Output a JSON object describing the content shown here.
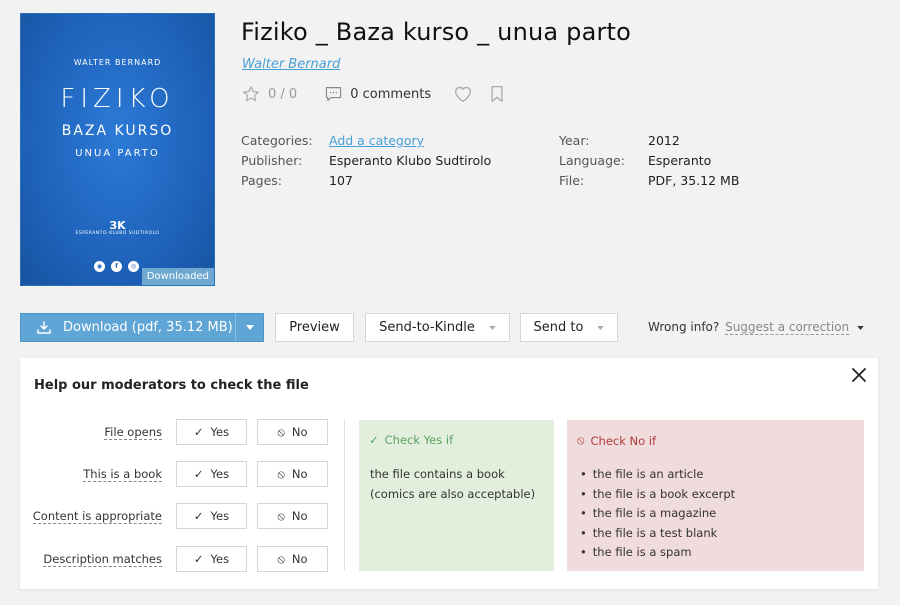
{
  "cover": {
    "author": "WALTER BERNARD",
    "title_line1": "FIZIKO",
    "title_line2": "BAZA KURSO",
    "title_line3": "UNUA PARTO",
    "publisher_logo": "ЗK",
    "publisher_name": "ESPERANTO-KLUBO SUDTIROLO",
    "badge": "Downloaded",
    "bg_color": "#1f63bb"
  },
  "book": {
    "title": "Fiziko _ Baza kurso _ unua parto",
    "author": "Walter Bernard",
    "rating": "0 / 0",
    "comments": "0 comments"
  },
  "details": {
    "categories_label": "Categories:",
    "categories_value": "Add a category",
    "publisher_label": "Publisher:",
    "publisher_value": "Esperanto Klubo Sudtirolo",
    "pages_label": "Pages:",
    "pages_value": "107",
    "year_label": "Year:",
    "year_value": "2012",
    "language_label": "Language:",
    "language_value": "Esperanto",
    "file_label": "File:",
    "file_value": "PDF, 35.12 MB"
  },
  "actions": {
    "download": "Download (pdf, 35.12 MB)",
    "preview": "Preview",
    "send_to_kindle": "Send-to-Kindle",
    "send_to": "Send to",
    "wrong_info": "Wrong info?",
    "suggest": "Suggest a correction"
  },
  "moderation": {
    "title": "Help our moderators to check the file",
    "rows": [
      {
        "label": "File opens",
        "yes": "Yes",
        "no": "No"
      },
      {
        "label": "This is a book",
        "yes": "Yes",
        "no": "No"
      },
      {
        "label": "Content is appropriate",
        "yes": "Yes",
        "no": "No"
      },
      {
        "label": "Description matches",
        "yes": "Yes",
        "no": "No"
      }
    ],
    "yes_box": {
      "heading": "Check Yes if",
      "line1": "the file contains a book",
      "line2": "(comics are also acceptable)"
    },
    "no_box": {
      "heading": "Check No if",
      "items": [
        "the file is an article",
        "the file is a book excerpt",
        "the file is a magazine",
        "the file is a test blank",
        "the file is a spam"
      ]
    }
  },
  "colors": {
    "accent": "#5fa6d6",
    "link": "#49a0d6",
    "yes_bg": "#e3efdd",
    "no_bg": "#f0dcdc"
  }
}
